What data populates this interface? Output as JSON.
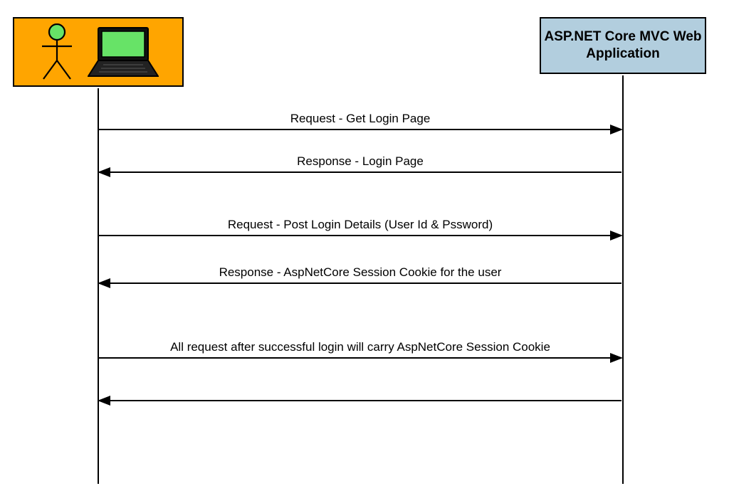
{
  "actors": {
    "server_title": "ASP.NET Core MVC Web Application"
  },
  "messages": {
    "m1": "Request - Get Login Page",
    "m2": "Response - Login Page",
    "m3": "Request - Post Login Details (User Id & Pssword)",
    "m4": "Response - AspNetCore Session Cookie for the user",
    "m5": "All request after successful login will carry AspNetCore Session Cookie",
    "m6": ""
  }
}
